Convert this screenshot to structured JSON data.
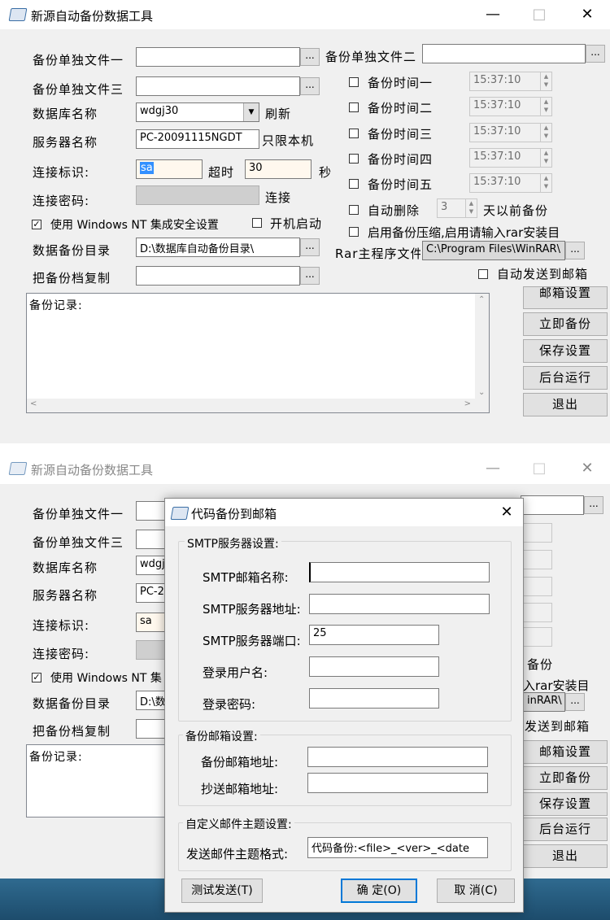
{
  "window": {
    "title": "新源自动备份数据工具",
    "min_icon": "minimize-icon",
    "max_icon": "maximize-icon",
    "close_icon": "close-icon"
  },
  "form": {
    "file1_label": "备份单独文件一",
    "file2_label": "备份单独文件二",
    "file3_label": "备份单独文件三",
    "browse_label": "...",
    "db_name_label": "数据库名称",
    "db_name_value": "wdgj30",
    "refresh_label": "刷新",
    "server_label": "服务器名称",
    "server_value": "PC-20091115NGDT",
    "local_only_label": "只限本机",
    "conn_id_label": "连接标识:",
    "conn_id_value": "sa",
    "timeout_label": "超时",
    "timeout_value": "30",
    "seconds_label": "秒",
    "conn_pwd_label": "连接密码:",
    "connect_label": "连接",
    "use_nt_label": "使用 Windows NT 集成安全设置",
    "autostart_label": "开机启动",
    "backup_dir_label": "数据备份目录",
    "backup_dir_value": "D:\\数据库自动备份目录\\",
    "copy_label": "把备份档复制",
    "times": [
      {
        "label": "备份时间一",
        "value": "15:37:10"
      },
      {
        "label": "备份时间二",
        "value": "15:37:10"
      },
      {
        "label": "备份时间三",
        "value": "15:37:10"
      },
      {
        "label": "备份时间四",
        "value": "15:37:10"
      },
      {
        "label": "备份时间五",
        "value": "15:37:10"
      }
    ],
    "auto_delete_label": "自动删除",
    "auto_delete_days": "3",
    "days_before_label": "天以前备份",
    "compress_label": "启用备份压缩,启用请输入rar安装目",
    "rar_label": "Rar主程序文件",
    "rar_value": "C:\\Program Files\\WinRAR\\",
    "send_mail_label": "自动发送到邮箱",
    "log_label": "备份记录:",
    "buttons": {
      "mail_settings": "邮箱设置",
      "backup_now": "立即备份",
      "save_settings": "保存设置",
      "background": "后台运行",
      "exit": "退出"
    }
  },
  "back_window": {
    "db_name_partial": "wdgj3",
    "server_partial": "PC-20",
    "conn_id_value": "sa",
    "use_nt_partial": "使用 Windows NT 集",
    "backup_dir_partial": "D:\\数",
    "days_before_partial": "备份",
    "compress_partial": "入rar安装目",
    "rar_partial": "inRAR\\",
    "send_mail_partial": "发送到邮箱"
  },
  "dialog": {
    "title": "代码备份到邮箱",
    "close_icon": "close-icon",
    "smtp_group": "SMTP服务器设置:",
    "smtp_name_label": "SMTP邮箱名称:",
    "smtp_addr_label": "SMTP服务器地址:",
    "smtp_port_label": "SMTP服务器端口:",
    "smtp_port_value": "25",
    "login_user_label": "登录用户名:",
    "login_pwd_label": "登录密码:",
    "backup_group": "备份邮箱设置:",
    "backup_addr_label": "备份邮箱地址:",
    "cc_addr_label": "抄送邮箱地址:",
    "subject_group": "自定义邮件主题设置:",
    "subject_label": "发送邮件主题格式:",
    "subject_value": "代码备份:<file>_<ver>_<date",
    "test_button": "测试发送(T)",
    "ok_button": "确 定(O)",
    "cancel_button": "取 消(C)"
  }
}
